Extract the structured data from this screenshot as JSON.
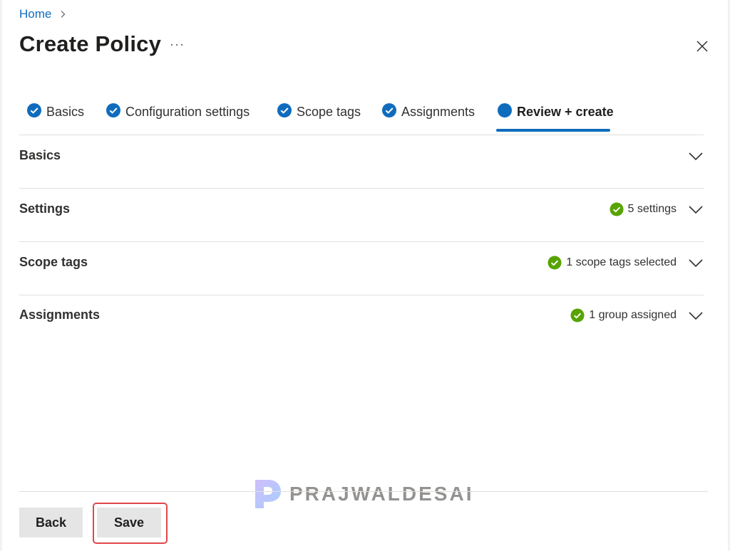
{
  "breadcrumb": {
    "home": "Home"
  },
  "page": {
    "title": "Create Policy",
    "more": "···"
  },
  "tabs": [
    {
      "label": "Basics",
      "state": "complete"
    },
    {
      "label": "Configuration settings",
      "state": "complete"
    },
    {
      "label": "Scope tags",
      "state": "complete"
    },
    {
      "label": "Assignments",
      "state": "complete"
    },
    {
      "label": "Review + create",
      "state": "active"
    }
  ],
  "sections": [
    {
      "title": "Basics",
      "status": ""
    },
    {
      "title": "Settings",
      "status": "5 settings"
    },
    {
      "title": "Scope tags",
      "status": "1 scope tags selected"
    },
    {
      "title": "Assignments",
      "status": "1 group assigned"
    }
  ],
  "footer": {
    "back": "Back",
    "save": "Save"
  },
  "watermark": {
    "text": "PRAJWALDESAI"
  },
  "colors": {
    "accent": "#0f6cbd",
    "success": "#57a300",
    "highlight": "#e0474c",
    "button_bg": "#e5e5e5"
  }
}
